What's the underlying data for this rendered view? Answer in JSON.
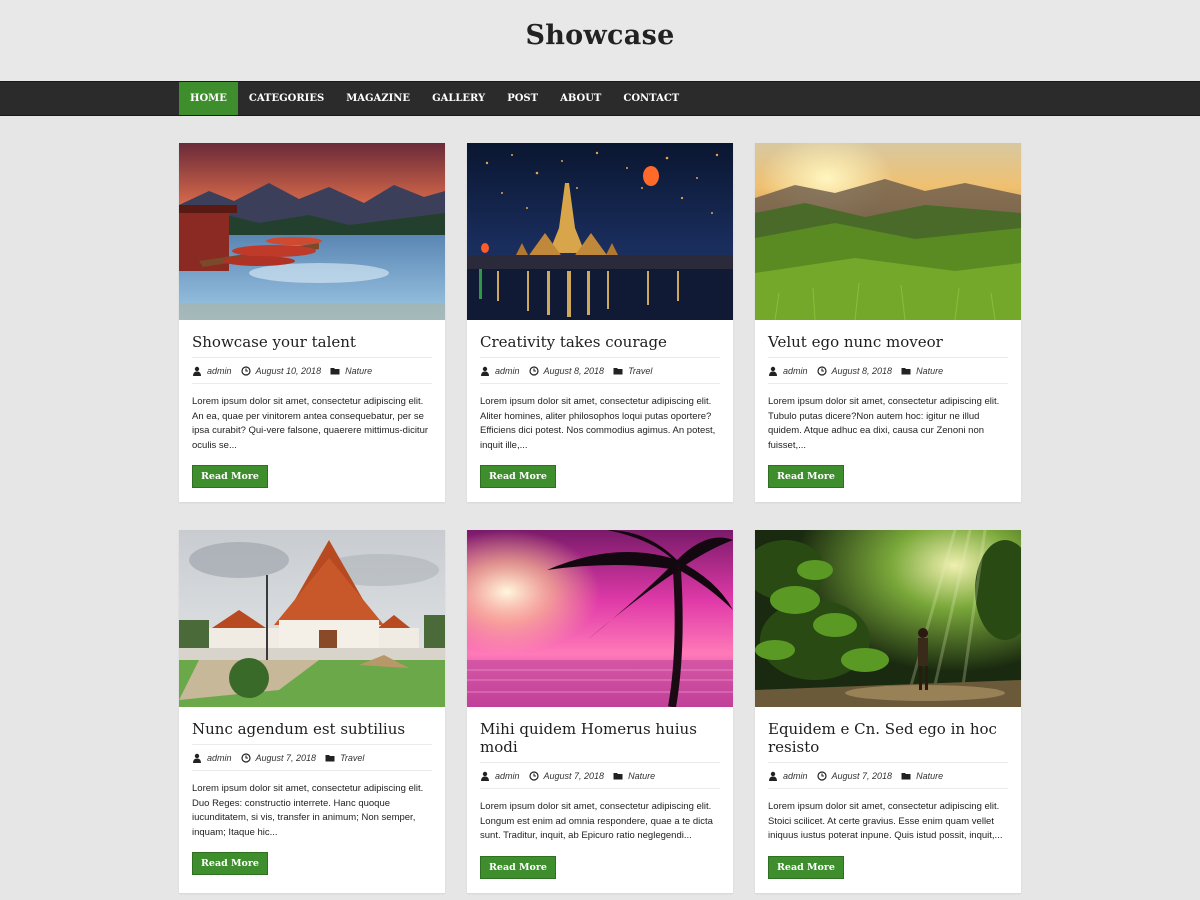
{
  "site": {
    "title": "Showcase"
  },
  "nav": {
    "items": [
      {
        "label": "HOME"
      },
      {
        "label": "CATEGORIES"
      },
      {
        "label": "MAGAZINE"
      },
      {
        "label": "GALLERY"
      },
      {
        "label": "POST"
      },
      {
        "label": "ABOUT"
      },
      {
        "label": "CONTACT"
      }
    ]
  },
  "colors": {
    "accent": "#3e8e2e",
    "nav_bg": "#2b2b2b",
    "page_bg": "#e6e6e6"
  },
  "posts": [
    {
      "title": "Showcase your talent",
      "author": "admin",
      "date": "August 10, 2018",
      "category": "Nature",
      "excerpt": "Lorem ipsum dolor sit amet, consectetur adipiscing elit. An ea, quae per vinitorem antea consequebatur, per se ipsa curabit? Qui-vere falsone, quaerere mittimus-dicitur oculis se...",
      "button": "Read More",
      "image": "mountain-lake-boats"
    },
    {
      "title": "Creativity takes courage",
      "author": "admin",
      "date": "August 8, 2018",
      "category": "Travel",
      "excerpt": "Lorem ipsum dolor sit amet, consectetur adipiscing elit. Aliter homines, aliter philosophos loqui putas oportere? Efficiens dici potest. Nos commodius agimus. An potest, inquit ille,...",
      "button": "Read More",
      "image": "temple-night-lanterns"
    },
    {
      "title": "Velut ego nunc moveor",
      "author": "admin",
      "date": "August 8, 2018",
      "category": "Nature",
      "excerpt": "Lorem ipsum dolor sit amet, consectetur adipiscing elit. Tubulo putas dicere?Non autem hoc: igitur ne illud quidem. Atque adhuc ea dixi, causa cur Zenoni non fuisset,...",
      "button": "Read More",
      "image": "green-hills-sunset"
    },
    {
      "title": "Nunc agendum est subtilius",
      "author": "admin",
      "date": "August 7, 2018",
      "category": "Travel",
      "excerpt": "Lorem ipsum dolor sit amet, consectetur adipiscing elit. Duo Reges: constructio interrete. Hanc quoque iucunditatem, si vis, transfer in animum; Non semper, inquam; Itaque hic...",
      "button": "Read More",
      "image": "thai-temple-day"
    },
    {
      "title": "Mihi quidem Homerus huius modi",
      "author": "admin",
      "date": "August 7, 2018",
      "category": "Nature",
      "excerpt": "Lorem ipsum dolor sit amet, consectetur adipiscing elit. Longum est enim ad omnia respondere, quae a te dicta sunt. Traditur, inquit, ab Epicuro ratio neglegendi...",
      "button": "Read More",
      "image": "palm-pink-sky"
    },
    {
      "title": "Equidem e Cn. Sed ego in hoc resisto",
      "author": "admin",
      "date": "August 7, 2018",
      "category": "Nature",
      "excerpt": "Lorem ipsum dolor sit amet, consectetur adipiscing elit. Stoici scilicet. At certe gravius. Esse enim quam vellet iniquus iustus poterat inpune. Quis istud possit, inquit,...",
      "button": "Read More",
      "image": "jungle-hiker"
    }
  ]
}
